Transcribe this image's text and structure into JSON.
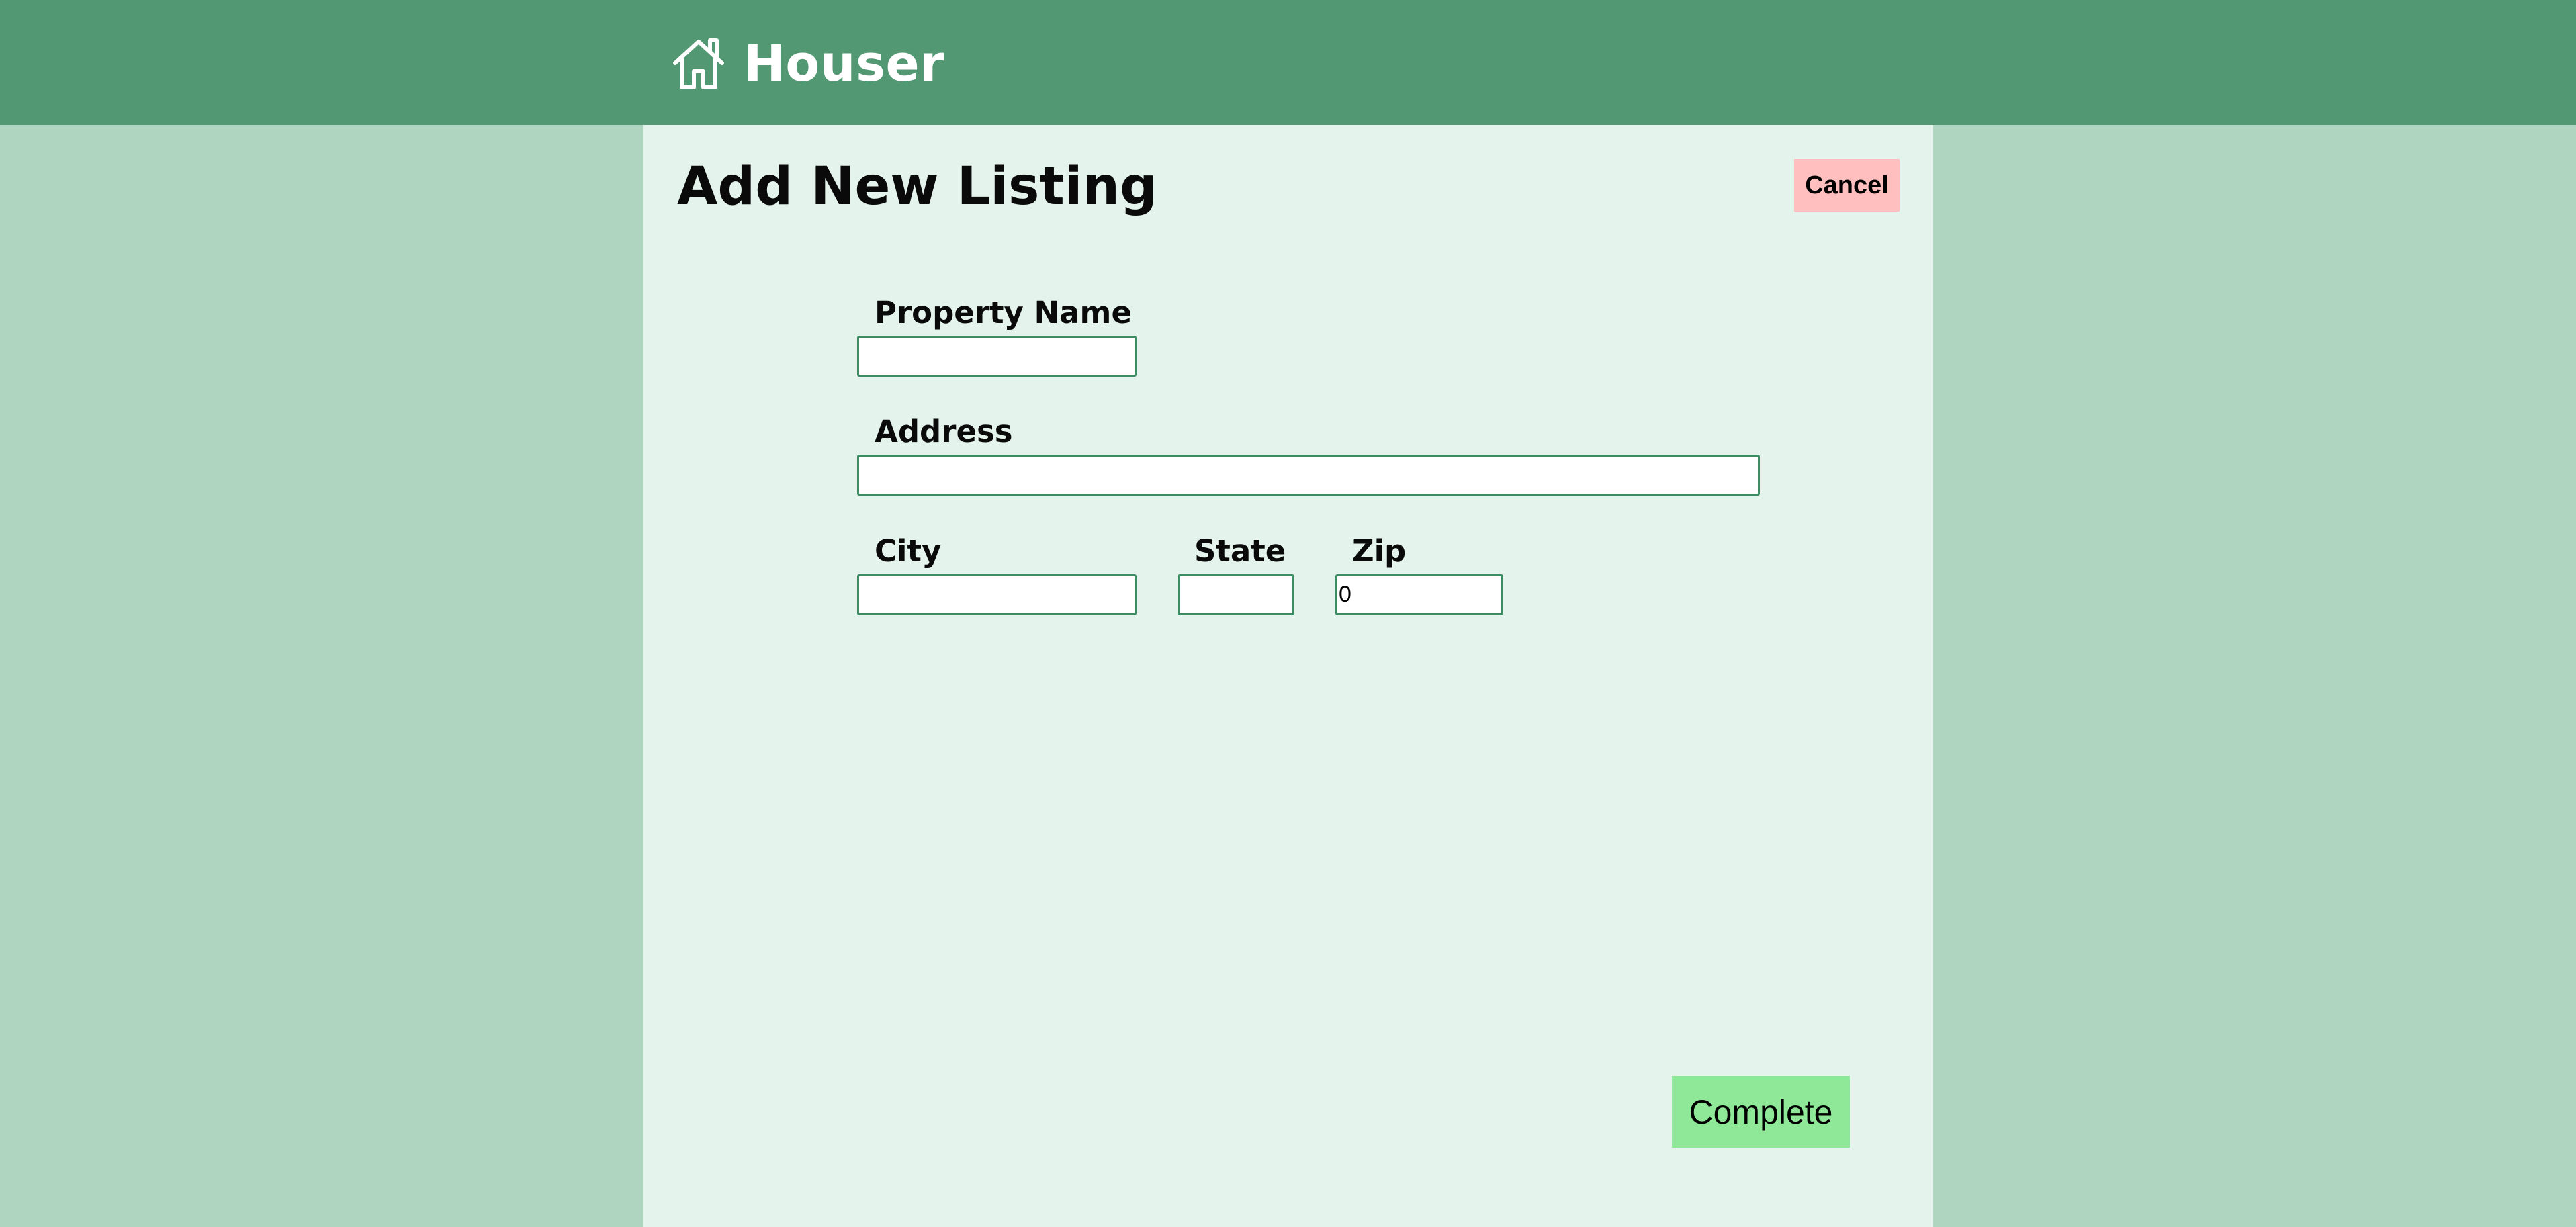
{
  "header": {
    "brand_icon": "home-icon",
    "brand_name": "Houser"
  },
  "page": {
    "title": "Add New Listing",
    "cancel_label": "Cancel",
    "complete_label": "Complete"
  },
  "form": {
    "property_name": {
      "label": "Property Name",
      "value": ""
    },
    "address": {
      "label": "Address",
      "value": ""
    },
    "city": {
      "label": "City",
      "value": ""
    },
    "state": {
      "label": "State",
      "value": ""
    },
    "zip": {
      "label": "Zip",
      "value": "0"
    }
  },
  "colors": {
    "header_bg": "#529873",
    "page_bg": "#afd5c0",
    "panel_bg": "#e4f3ec",
    "cancel_bg": "#ffbfbf",
    "complete_bg": "#8fe898",
    "input_border": "#3d8b63"
  }
}
